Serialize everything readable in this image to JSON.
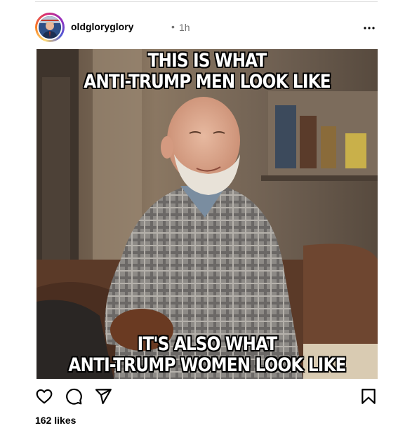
{
  "post": {
    "username": "oldgloryglory",
    "separator": "•",
    "time": "1h",
    "likes": "162 likes"
  },
  "meme": {
    "top_line_1": "THIS IS WHAT",
    "top_line_2": "ANTI-TRUMP MEN LOOK LIKE",
    "bottom_line_1": "IT'S ALSO WHAT",
    "bottom_line_2": "ANTI-TRUMP WOMEN LOOK LIKE"
  },
  "icons": {
    "more": "more-options-icon",
    "like": "heart-icon",
    "comment": "comment-icon",
    "share": "share-icon",
    "save": "bookmark-icon"
  },
  "colors": {
    "text": "#000000",
    "secondary_text": "#737373",
    "divider": "#dbdbdb"
  }
}
